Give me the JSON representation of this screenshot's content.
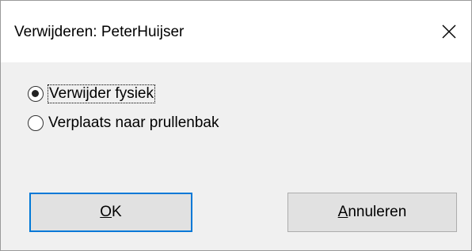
{
  "dialog": {
    "title": "Verwijderen: PeterHuijser",
    "close_icon": "close-icon"
  },
  "options": {
    "delete_physical": {
      "label": "Verwijder fysiek",
      "selected": true
    },
    "move_to_trash": {
      "label": "Verplaats naar prullenbak",
      "selected": false
    }
  },
  "buttons": {
    "ok_accel": "O",
    "ok_rest": "K",
    "cancel_accel": "A",
    "cancel_rest": "nnuleren"
  },
  "colors": {
    "accent": "#0078d7",
    "button_bg": "#e1e1e1",
    "dialog_bg": "#f0f0f0"
  }
}
